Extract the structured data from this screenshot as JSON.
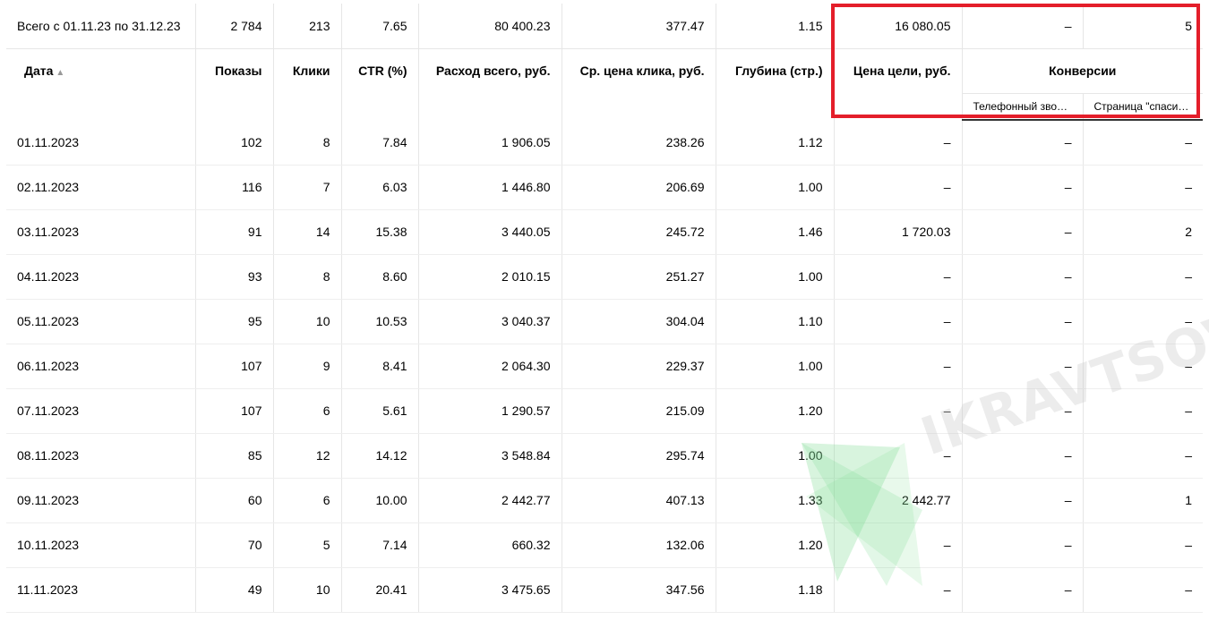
{
  "total": {
    "label": "Всего с 01.11.23 по 31.12.23",
    "impressions": "2 784",
    "clicks": "213",
    "ctr": "7.65",
    "cost": "80 400.23",
    "avg_cpc": "377.47",
    "depth": "1.15",
    "goal_price": "16 080.05",
    "conv_phone": "–",
    "conv_thanks": "5"
  },
  "headers": {
    "date": "Дата",
    "sort_indicator": "▲",
    "impressions": "Показы",
    "clicks": "Клики",
    "ctr": "CTR (%)",
    "cost": "Расход всего, руб.",
    "avg_cpc": "Ср. цена клика, руб.",
    "depth": "Глубина (стр.)",
    "goal_price": "Цена цели, руб.",
    "conversions": "Конверсии",
    "conv_phone": "Телефонный звонок",
    "conv_thanks": "Страница \"спасибо\""
  },
  "rows": [
    {
      "date": "01.11.2023",
      "impressions": "102",
      "clicks": "8",
      "ctr": "7.84",
      "cost": "1 906.05",
      "avg_cpc": "238.26",
      "depth": "1.12",
      "goal_price": "–",
      "conv_phone": "–",
      "conv_thanks": "–"
    },
    {
      "date": "02.11.2023",
      "impressions": "116",
      "clicks": "7",
      "ctr": "6.03",
      "cost": "1 446.80",
      "avg_cpc": "206.69",
      "depth": "1.00",
      "goal_price": "–",
      "conv_phone": "–",
      "conv_thanks": "–"
    },
    {
      "date": "03.11.2023",
      "impressions": "91",
      "clicks": "14",
      "ctr": "15.38",
      "cost": "3 440.05",
      "avg_cpc": "245.72",
      "depth": "1.46",
      "goal_price": "1 720.03",
      "conv_phone": "–",
      "conv_thanks": "2"
    },
    {
      "date": "04.11.2023",
      "impressions": "93",
      "clicks": "8",
      "ctr": "8.60",
      "cost": "2 010.15",
      "avg_cpc": "251.27",
      "depth": "1.00",
      "goal_price": "–",
      "conv_phone": "–",
      "conv_thanks": "–"
    },
    {
      "date": "05.11.2023",
      "impressions": "95",
      "clicks": "10",
      "ctr": "10.53",
      "cost": "3 040.37",
      "avg_cpc": "304.04",
      "depth": "1.10",
      "goal_price": "–",
      "conv_phone": "–",
      "conv_thanks": "–"
    },
    {
      "date": "06.11.2023",
      "impressions": "107",
      "clicks": "9",
      "ctr": "8.41",
      "cost": "2 064.30",
      "avg_cpc": "229.37",
      "depth": "1.00",
      "goal_price": "–",
      "conv_phone": "–",
      "conv_thanks": "–"
    },
    {
      "date": "07.11.2023",
      "impressions": "107",
      "clicks": "6",
      "ctr": "5.61",
      "cost": "1 290.57",
      "avg_cpc": "215.09",
      "depth": "1.20",
      "goal_price": "–",
      "conv_phone": "–",
      "conv_thanks": "–"
    },
    {
      "date": "08.11.2023",
      "impressions": "85",
      "clicks": "12",
      "ctr": "14.12",
      "cost": "3 548.84",
      "avg_cpc": "295.74",
      "depth": "1.00",
      "goal_price": "–",
      "conv_phone": "–",
      "conv_thanks": "–"
    },
    {
      "date": "09.11.2023",
      "impressions": "60",
      "clicks": "6",
      "ctr": "10.00",
      "cost": "2 442.77",
      "avg_cpc": "407.13",
      "depth": "1.33",
      "goal_price": "2 442.77",
      "conv_phone": "–",
      "conv_thanks": "1"
    },
    {
      "date": "10.11.2023",
      "impressions": "70",
      "clicks": "5",
      "ctr": "7.14",
      "cost": "660.32",
      "avg_cpc": "132.06",
      "depth": "1.20",
      "goal_price": "–",
      "conv_phone": "–",
      "conv_thanks": "–"
    },
    {
      "date": "11.11.2023",
      "impressions": "49",
      "clicks": "10",
      "ctr": "20.41",
      "cost": "3 475.65",
      "avg_cpc": "347.56",
      "depth": "1.18",
      "goal_price": "–",
      "conv_phone": "–",
      "conv_thanks": "–"
    }
  ],
  "watermark": {
    "text": "IKRAVTSOV",
    "color": "#7ddc92"
  },
  "highlight_color": "#e41e2a"
}
